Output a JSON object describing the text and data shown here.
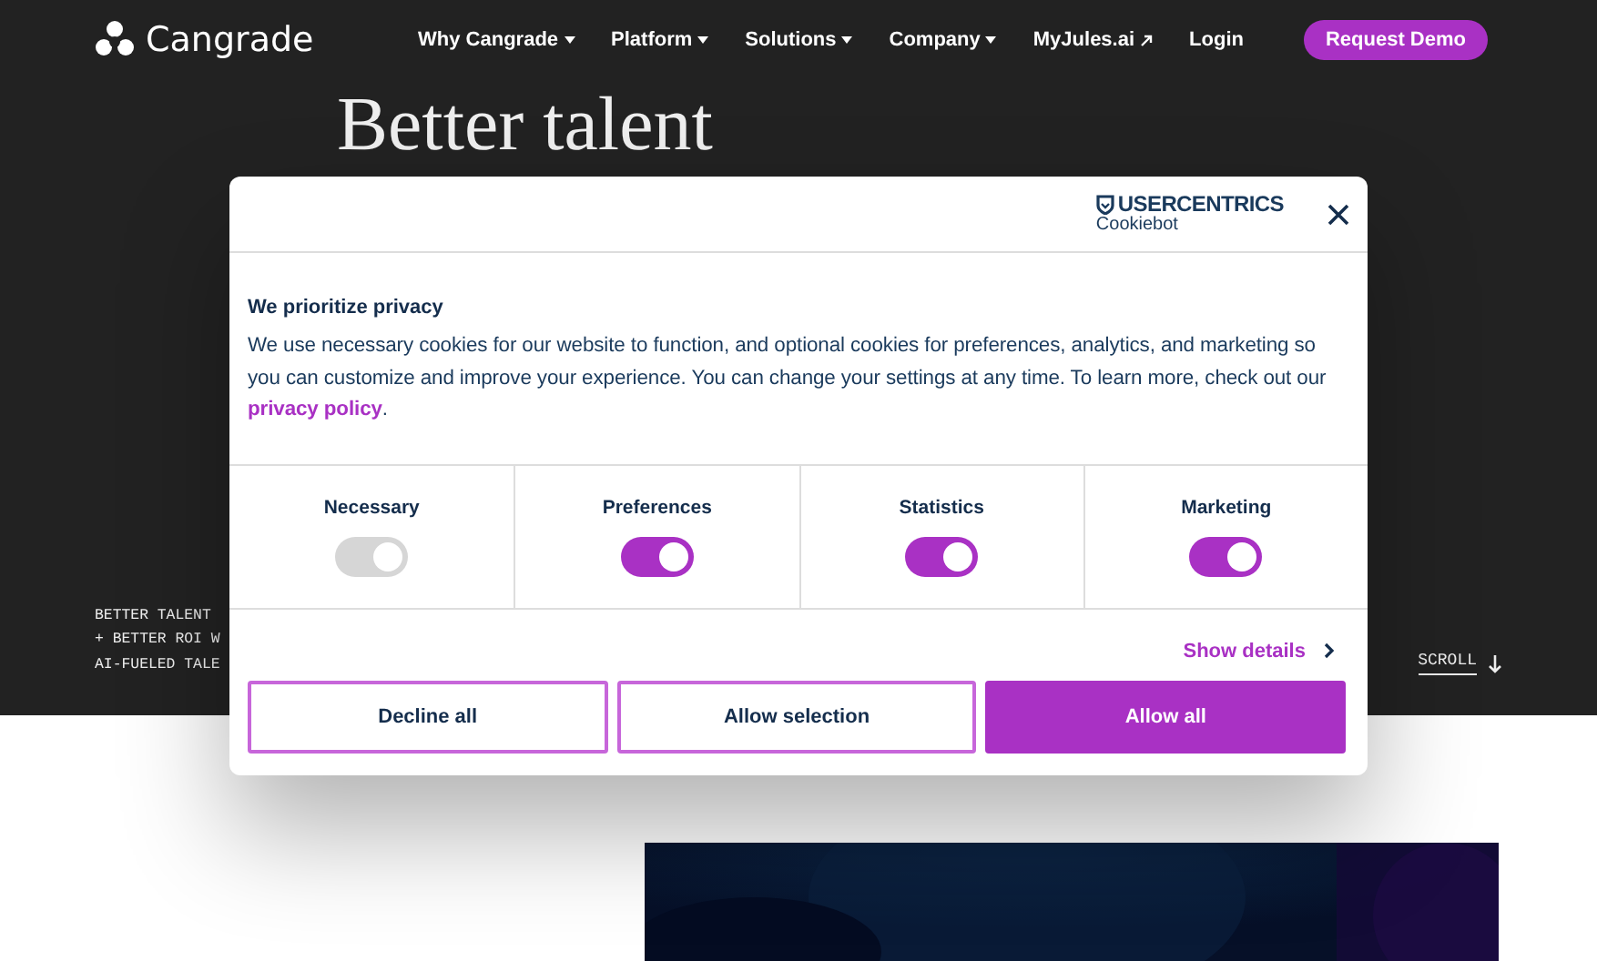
{
  "header": {
    "logo": "Cangrade",
    "nav": [
      {
        "label": "Why Cangrade",
        "kind": "dropdown"
      },
      {
        "label": "Platform",
        "kind": "dropdown"
      },
      {
        "label": "Solutions",
        "kind": "dropdown"
      },
      {
        "label": "Company",
        "kind": "dropdown"
      },
      {
        "label": "MyJules.ai",
        "kind": "external"
      },
      {
        "label": "Login",
        "kind": "link"
      }
    ],
    "cta": "Request Demo"
  },
  "hero": {
    "heading": "Better talent",
    "tagline": [
      "BETTER TALENT",
      "+ BETTER ROI W",
      "AI-FUELED TALE"
    ],
    "scroll": "SCROLL"
  },
  "cookie_dialog": {
    "brand": "USERCENTRICS",
    "brand_sub": "Cookiebot",
    "title": "We prioritize privacy",
    "text": "We use necessary cookies for our website to function, and optional cookies for preferences, analytics, and marketing so you can customize and improve your experience. You can change your settings at any time. To learn more, check out our",
    "link": "privacy policy",
    "link_after": ".",
    "categories": [
      {
        "label": "Necessary",
        "checked": true,
        "disabled": true
      },
      {
        "label": "Preferences",
        "checked": true,
        "disabled": false
      },
      {
        "label": "Statistics",
        "checked": true,
        "disabled": false
      },
      {
        "label": "Marketing",
        "checked": true,
        "disabled": false
      }
    ],
    "show_details": "Show details",
    "buttons": [
      {
        "label": "Decline all",
        "kind": "outline"
      },
      {
        "label": "Allow selection",
        "kind": "outline"
      },
      {
        "label": "Allow all",
        "kind": "primary"
      }
    ]
  }
}
